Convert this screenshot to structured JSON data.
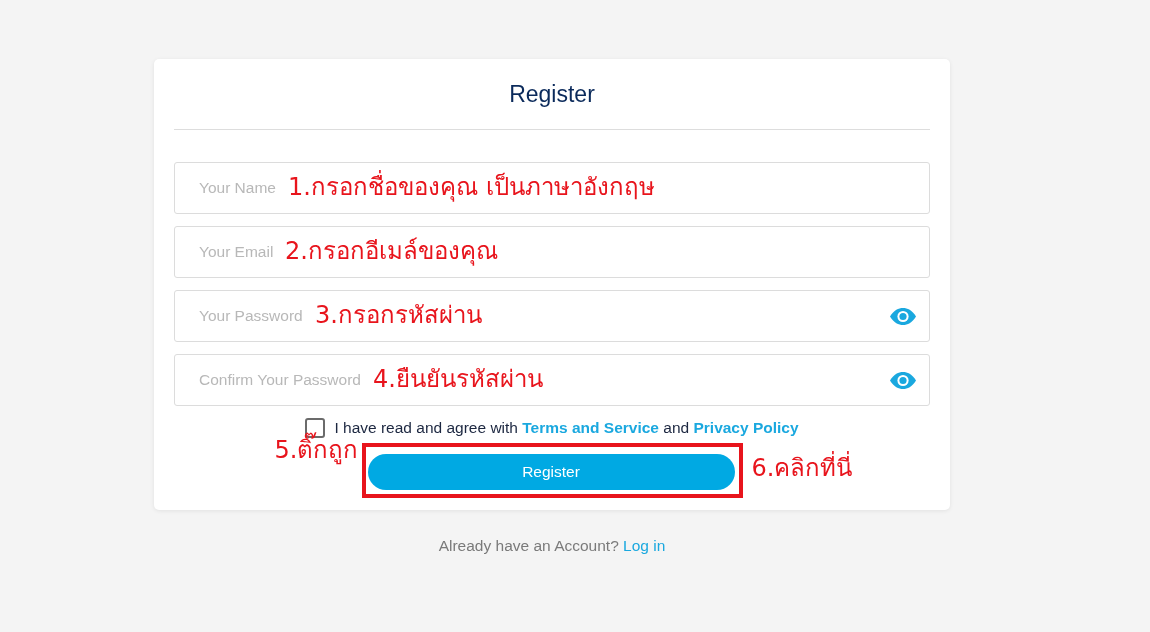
{
  "title": "Register",
  "fields": [
    {
      "kind": "name",
      "placeholder": "Your Name",
      "annotation": "1.กรอกชื่อของคุณ เป็นภาษาอังกฤษ"
    },
    {
      "kind": "email",
      "placeholder": "Your Email",
      "annotation": "2.กรอกอีเมล์ของคุณ"
    },
    {
      "kind": "password",
      "placeholder": "Your Password",
      "annotation": "3.กรอกรหัสผ่าน"
    },
    {
      "kind": "password",
      "placeholder": "Confirm Your Password",
      "annotation": "4.ยืนยันรหัสผ่าน"
    }
  ],
  "agreement": {
    "checked": false,
    "text": "I have read and agree with",
    "terms_link": "Terms and Service",
    "joiner": "and",
    "privacy_link": "Privacy Policy",
    "annotation": "5.ติ๊กถูก"
  },
  "register_button": {
    "label": "Register",
    "highlighted": true,
    "annotation": "6.คลิกที่นี่"
  },
  "login_prompt": {
    "text": "Already have an Account?",
    "link": "Log in"
  }
}
